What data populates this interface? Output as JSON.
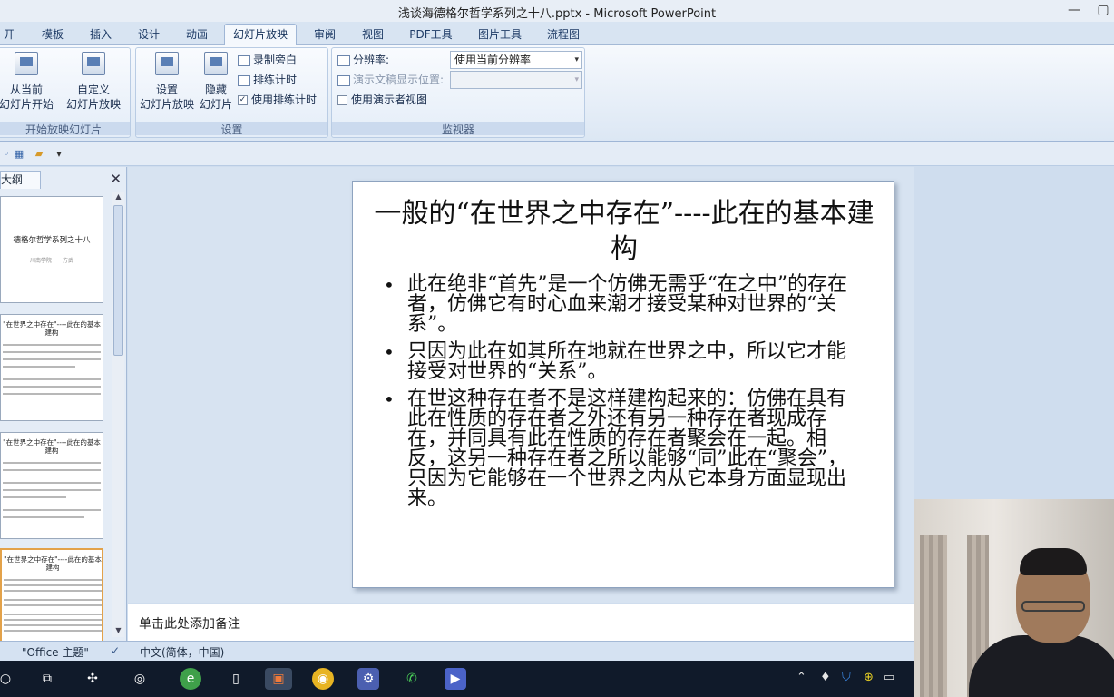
{
  "window": {
    "title": "浅谈海德格尔哲学系列之十八.pptx - Microsoft PowerPoint",
    "minimize": "—",
    "maximize": "▢"
  },
  "tabs": [
    "开始",
    "模板",
    "插入",
    "设计",
    "动画",
    "幻灯片放映",
    "审阅",
    "视图",
    "PDF工具",
    "图片工具",
    "流程图"
  ],
  "active_tab": "幻灯片放映",
  "ribbon": {
    "group_start": {
      "label": "开始放映幻灯片",
      "from_current_l1": "从当前",
      "from_current_l2": "幻灯片开始",
      "custom_l1": "自定义",
      "custom_l2": "幻灯片放映"
    },
    "group_setup": {
      "label": "设置",
      "setup_l1": "设置",
      "setup_l2": "幻灯片放映",
      "hide_l1": "隐藏",
      "hide_l2": "幻灯片",
      "record": "录制旁白",
      "rehearse": "排练计时",
      "use_timings": "使用排练计时",
      "use_timings_checked": true
    },
    "group_monitors": {
      "label": "监视器",
      "resolution_label": "分辨率:",
      "resolution_value": "使用当前分辨率",
      "show_on_label": "演示文稿显示位置:",
      "show_on_value": "",
      "presenter_view": "使用演示者视图",
      "presenter_view_checked": false
    }
  },
  "left_panel": {
    "tab": "大纲",
    "close": "✕",
    "thumbnails": [
      {
        "title": "德格尔哲学系列之十八",
        "subtitle": "川南学院　　方武",
        "selected": false
      },
      {
        "title": "\"在世界之中存在\"----此在的基本建构",
        "selected": false
      },
      {
        "title": "\"在世界之中存在\"----此在的基本建构",
        "selected": false
      },
      {
        "title": "\"在世界之中存在\"----此在的基本建构",
        "selected": true
      }
    ]
  },
  "slide": {
    "title": "一般的“在世界之中存在”----此在的基本建构",
    "bullet_char": "•",
    "bullets": [
      "此在绝非“首先”是一个仿佛无需乎“在之中”的存在者，仿佛它有时心血来潮才接受某种对世界的“关系”。",
      "只因为此在如其所在地就在世界之中，所以它才能接受对世界的“关系”。",
      "在世这种存在者不是这样建构起来的：仿佛在具有此在性质的存在者之外还有另一种存在者现成存在，并同具有此在性质的存在者聚会在一起。相反，这另一种存在者之所以能够“同”此在“聚会”，只因为它能够在一个世界之内从它本身方面显现出来。"
    ]
  },
  "notes": {
    "placeholder": "单击此处添加备注"
  },
  "statusbar": {
    "theme": "\"Office 主题\"",
    "language": "中文(简体，中国)"
  },
  "colors": {
    "ribbon_bg": "#dce7f4",
    "canvas_bg": "#d7e3f1",
    "taskbar_bg": "#101a2a",
    "selected_thumb_border": "#e3a24a"
  }
}
